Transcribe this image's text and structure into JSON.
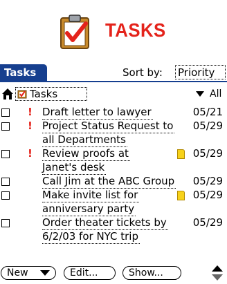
{
  "header": {
    "title": "TASKS"
  },
  "app": {
    "title": "Tasks",
    "sort_label": "Sort by:",
    "sort_value": "Priority",
    "category": "Tasks",
    "filter": "All"
  },
  "lines": [
    {
      "checkbox": true,
      "priority": "!",
      "text": "Draft letter to lawyer",
      "due": "05/21"
    },
    {
      "checkbox": true,
      "priority": "!",
      "text": "Project Status Request to",
      "due": "05/29"
    },
    {
      "checkbox": false,
      "priority": "",
      "text": "all Departments",
      "due": ""
    },
    {
      "checkbox": true,
      "priority": "!",
      "text": "Review proofs at",
      "due": "05/29",
      "note": true
    },
    {
      "checkbox": false,
      "priority": "",
      "text": "Janet's desk",
      "due": ""
    },
    {
      "checkbox": true,
      "priority": "",
      "text": "Call Jim at the ABC Group",
      "due": "05/29"
    },
    {
      "checkbox": true,
      "priority": "",
      "text": "Make invite list for",
      "due": "05/29",
      "note": true
    },
    {
      "checkbox": false,
      "priority": "",
      "text": "anniversary party",
      "due": ""
    },
    {
      "checkbox": true,
      "priority": "",
      "text": "Order theater tickets by",
      "due": "05/29"
    },
    {
      "checkbox": false,
      "priority": "",
      "text": "6/2/03 for NYC trip",
      "due": ""
    }
  ],
  "buttons": {
    "new": "New",
    "edit": "Edit...",
    "show": "Show..."
  },
  "colors": {
    "accent": "#163f8f",
    "priority": "#e4231b",
    "note": "#f7d21a"
  }
}
